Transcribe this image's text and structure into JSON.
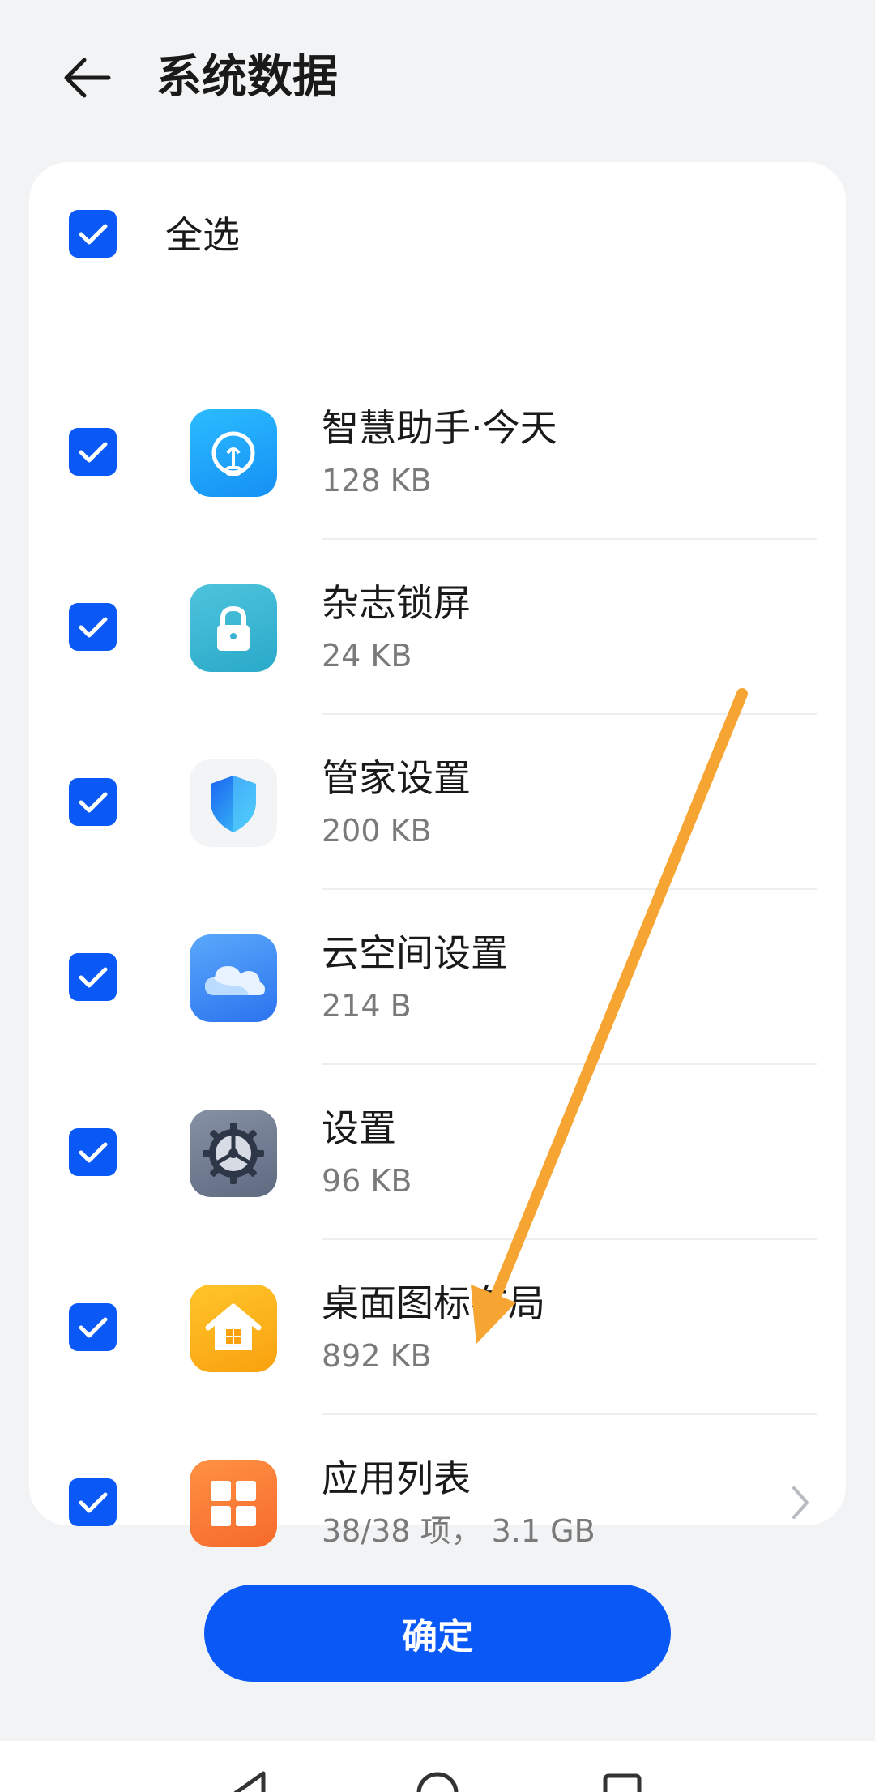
{
  "header": {
    "title": "系统数据",
    "back_icon": "arrow-left-icon"
  },
  "select_all": {
    "label": "全选",
    "checked": true
  },
  "items": [
    {
      "name": "智慧助手·今天",
      "size": "128 KB",
      "icon": "lightbulb-icon",
      "icon_color": "#1aa7fb",
      "checked": true
    },
    {
      "name": "杂志锁屏",
      "size": "24 KB",
      "icon": "lock-icon",
      "icon_color": "#39b4d2",
      "checked": true
    },
    {
      "name": "管家设置",
      "size": "200 KB",
      "icon": "shield-icon",
      "icon_color": "#2a7bf0",
      "checked": true
    },
    {
      "name": "云空间设置",
      "size": "214 B",
      "icon": "cloud-icon",
      "icon_color": "#3f8ef4",
      "checked": true
    },
    {
      "name": "设置",
      "size": "96 KB",
      "icon": "gear-icon",
      "icon_color": "#6b778c",
      "checked": true
    },
    {
      "name": "桌面图标布局",
      "size": "892 KB",
      "icon": "home-icon",
      "icon_color": "#fbae16",
      "checked": true
    },
    {
      "name": "应用列表",
      "size": "38/38 项， 3.1 GB",
      "icon": "app-grid-icon",
      "icon_color": "#f97a35",
      "checked": true,
      "has_chevron": true
    }
  ],
  "confirm_button": {
    "label": "确定"
  },
  "colors": {
    "accent": "#0a59f7",
    "background": "#f1f3f5",
    "annotation_arrow": "#f7a532"
  },
  "navigation": {
    "back": "nav-back-icon",
    "home": "nav-home-icon",
    "recents": "nav-recents-icon"
  }
}
